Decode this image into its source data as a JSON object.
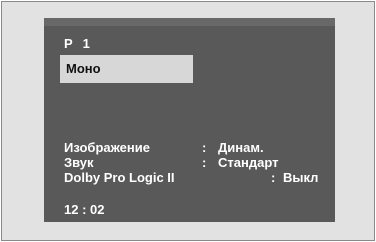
{
  "osd": {
    "program": "P  1",
    "sound_mode": "Моно",
    "settings": [
      {
        "label": "Изображение",
        "separator": ":",
        "value": "Динам."
      },
      {
        "label": "Звук",
        "separator": ":",
        "value": "Стандарт"
      },
      {
        "label": "Dolby Pro Logic II",
        "separator": ":",
        "value": "Выкл"
      }
    ],
    "time": "12 : 02"
  },
  "colors": {
    "panel": "#595959",
    "highlight": "#d7d7d7",
    "frame": "#e2e2e2",
    "text": "#ffffff"
  }
}
